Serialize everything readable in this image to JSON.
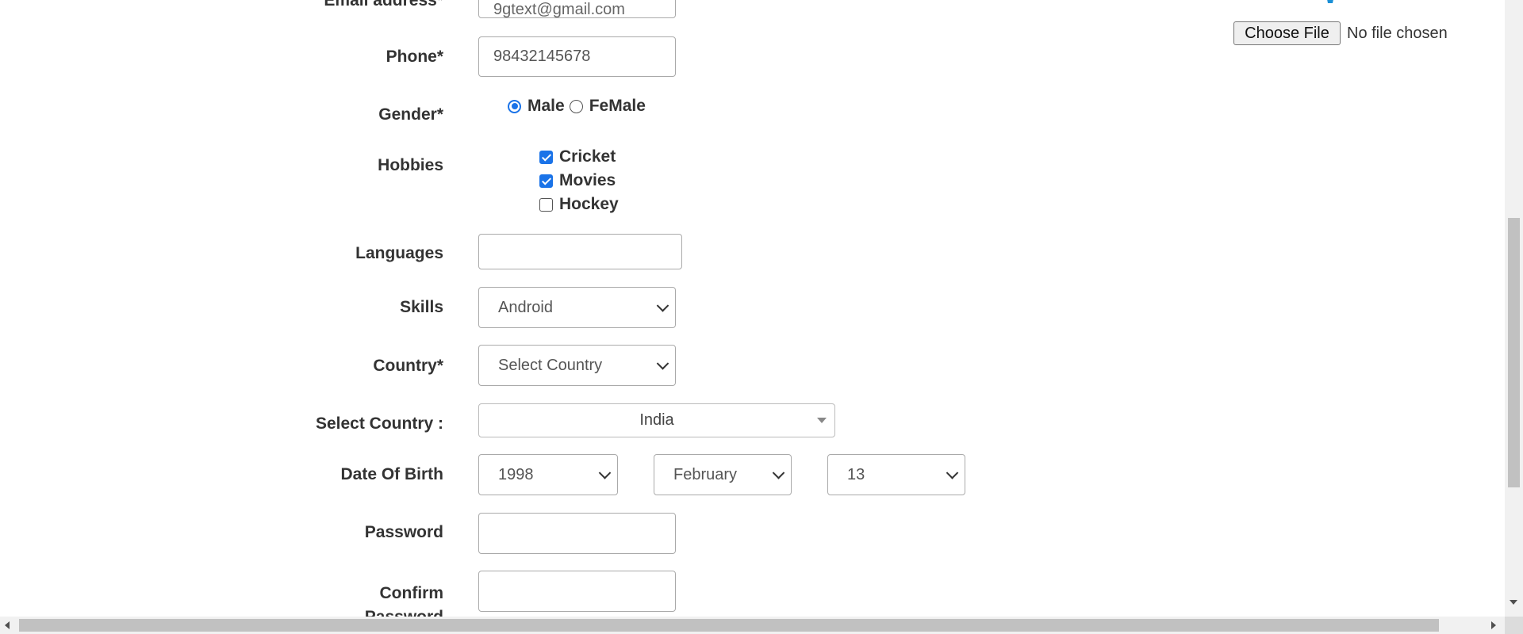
{
  "form": {
    "email": {
      "label": "Email address*",
      "value": "9gtext@gmail.com"
    },
    "phone": {
      "label": "Phone*",
      "value": "98432145678"
    },
    "gender": {
      "label": "Gender*",
      "options": [
        "Male",
        "FeMale"
      ],
      "selected": "Male"
    },
    "hobbies": {
      "label": "Hobbies",
      "items": [
        {
          "label": "Cricket",
          "checked": true
        },
        {
          "label": "Movies",
          "checked": true
        },
        {
          "label": "Hockey",
          "checked": false
        }
      ]
    },
    "languages": {
      "label": "Languages",
      "value": ""
    },
    "skills": {
      "label": "Skills",
      "value": "Android"
    },
    "country": {
      "label": "Country*",
      "value": "Select Country"
    },
    "select_country": {
      "label": "Select Country :",
      "value": "India"
    },
    "dob": {
      "label": "Date Of Birth",
      "year": "1998",
      "month": "February",
      "day": "13"
    },
    "password": {
      "label": "Password",
      "value": ""
    },
    "confirm_password": {
      "label": "Confirm Password",
      "value": ""
    }
  },
  "upload": {
    "button_label": "Choose File",
    "status": "No file chosen"
  }
}
